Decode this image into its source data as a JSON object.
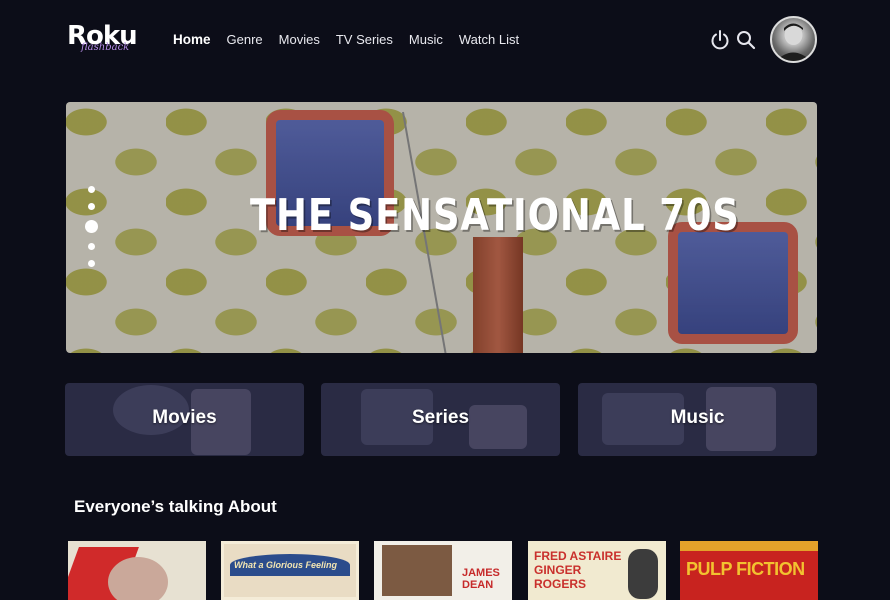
{
  "brand": {
    "logo_text": "Roku",
    "logo_subtext": "flashback"
  },
  "nav": {
    "items": [
      {
        "label": "Home",
        "active": true
      },
      {
        "label": "Genre",
        "active": false
      },
      {
        "label": "Movies",
        "active": false
      },
      {
        "label": "TV Series",
        "active": false
      },
      {
        "label": "Music",
        "active": false
      },
      {
        "label": "Watch List",
        "active": false
      }
    ]
  },
  "header_icons": {
    "power": "power-icon",
    "search": "search-icon",
    "avatar": "user-avatar"
  },
  "hero": {
    "title": "The Sensational 70s",
    "carousel": {
      "count": 5,
      "active_index": 2
    }
  },
  "categories": [
    {
      "label": "Movies",
      "icon": "film-reel-popcorn"
    },
    {
      "label": "Series",
      "icon": "tv-couch"
    },
    {
      "label": "Music",
      "icon": "cassette-boombox"
    }
  ],
  "section": {
    "title": "Everyone’s talking About"
  },
  "posters": [
    {
      "text": "",
      "bg": "#e7e1d2",
      "accent": "#d02a2a"
    },
    {
      "text": "What a Glorious Feeling",
      "bg": "#e9dcc4",
      "accent": "#2b4c8c"
    },
    {
      "text": "JAMES DEAN",
      "bg": "#f2efe8",
      "accent": "#c62a2a"
    },
    {
      "text": "FRED ASTAIRE GINGER ROGERS",
      "bg": "#f1ead0",
      "accent": "#c9302c"
    },
    {
      "text": "PULP FICTION",
      "bg": "#c8231f",
      "accent": "#f2c230"
    }
  ],
  "colors": {
    "background": "#0c0d18",
    "tile": "#2a2b44",
    "accent_purple": "#b48be6"
  }
}
